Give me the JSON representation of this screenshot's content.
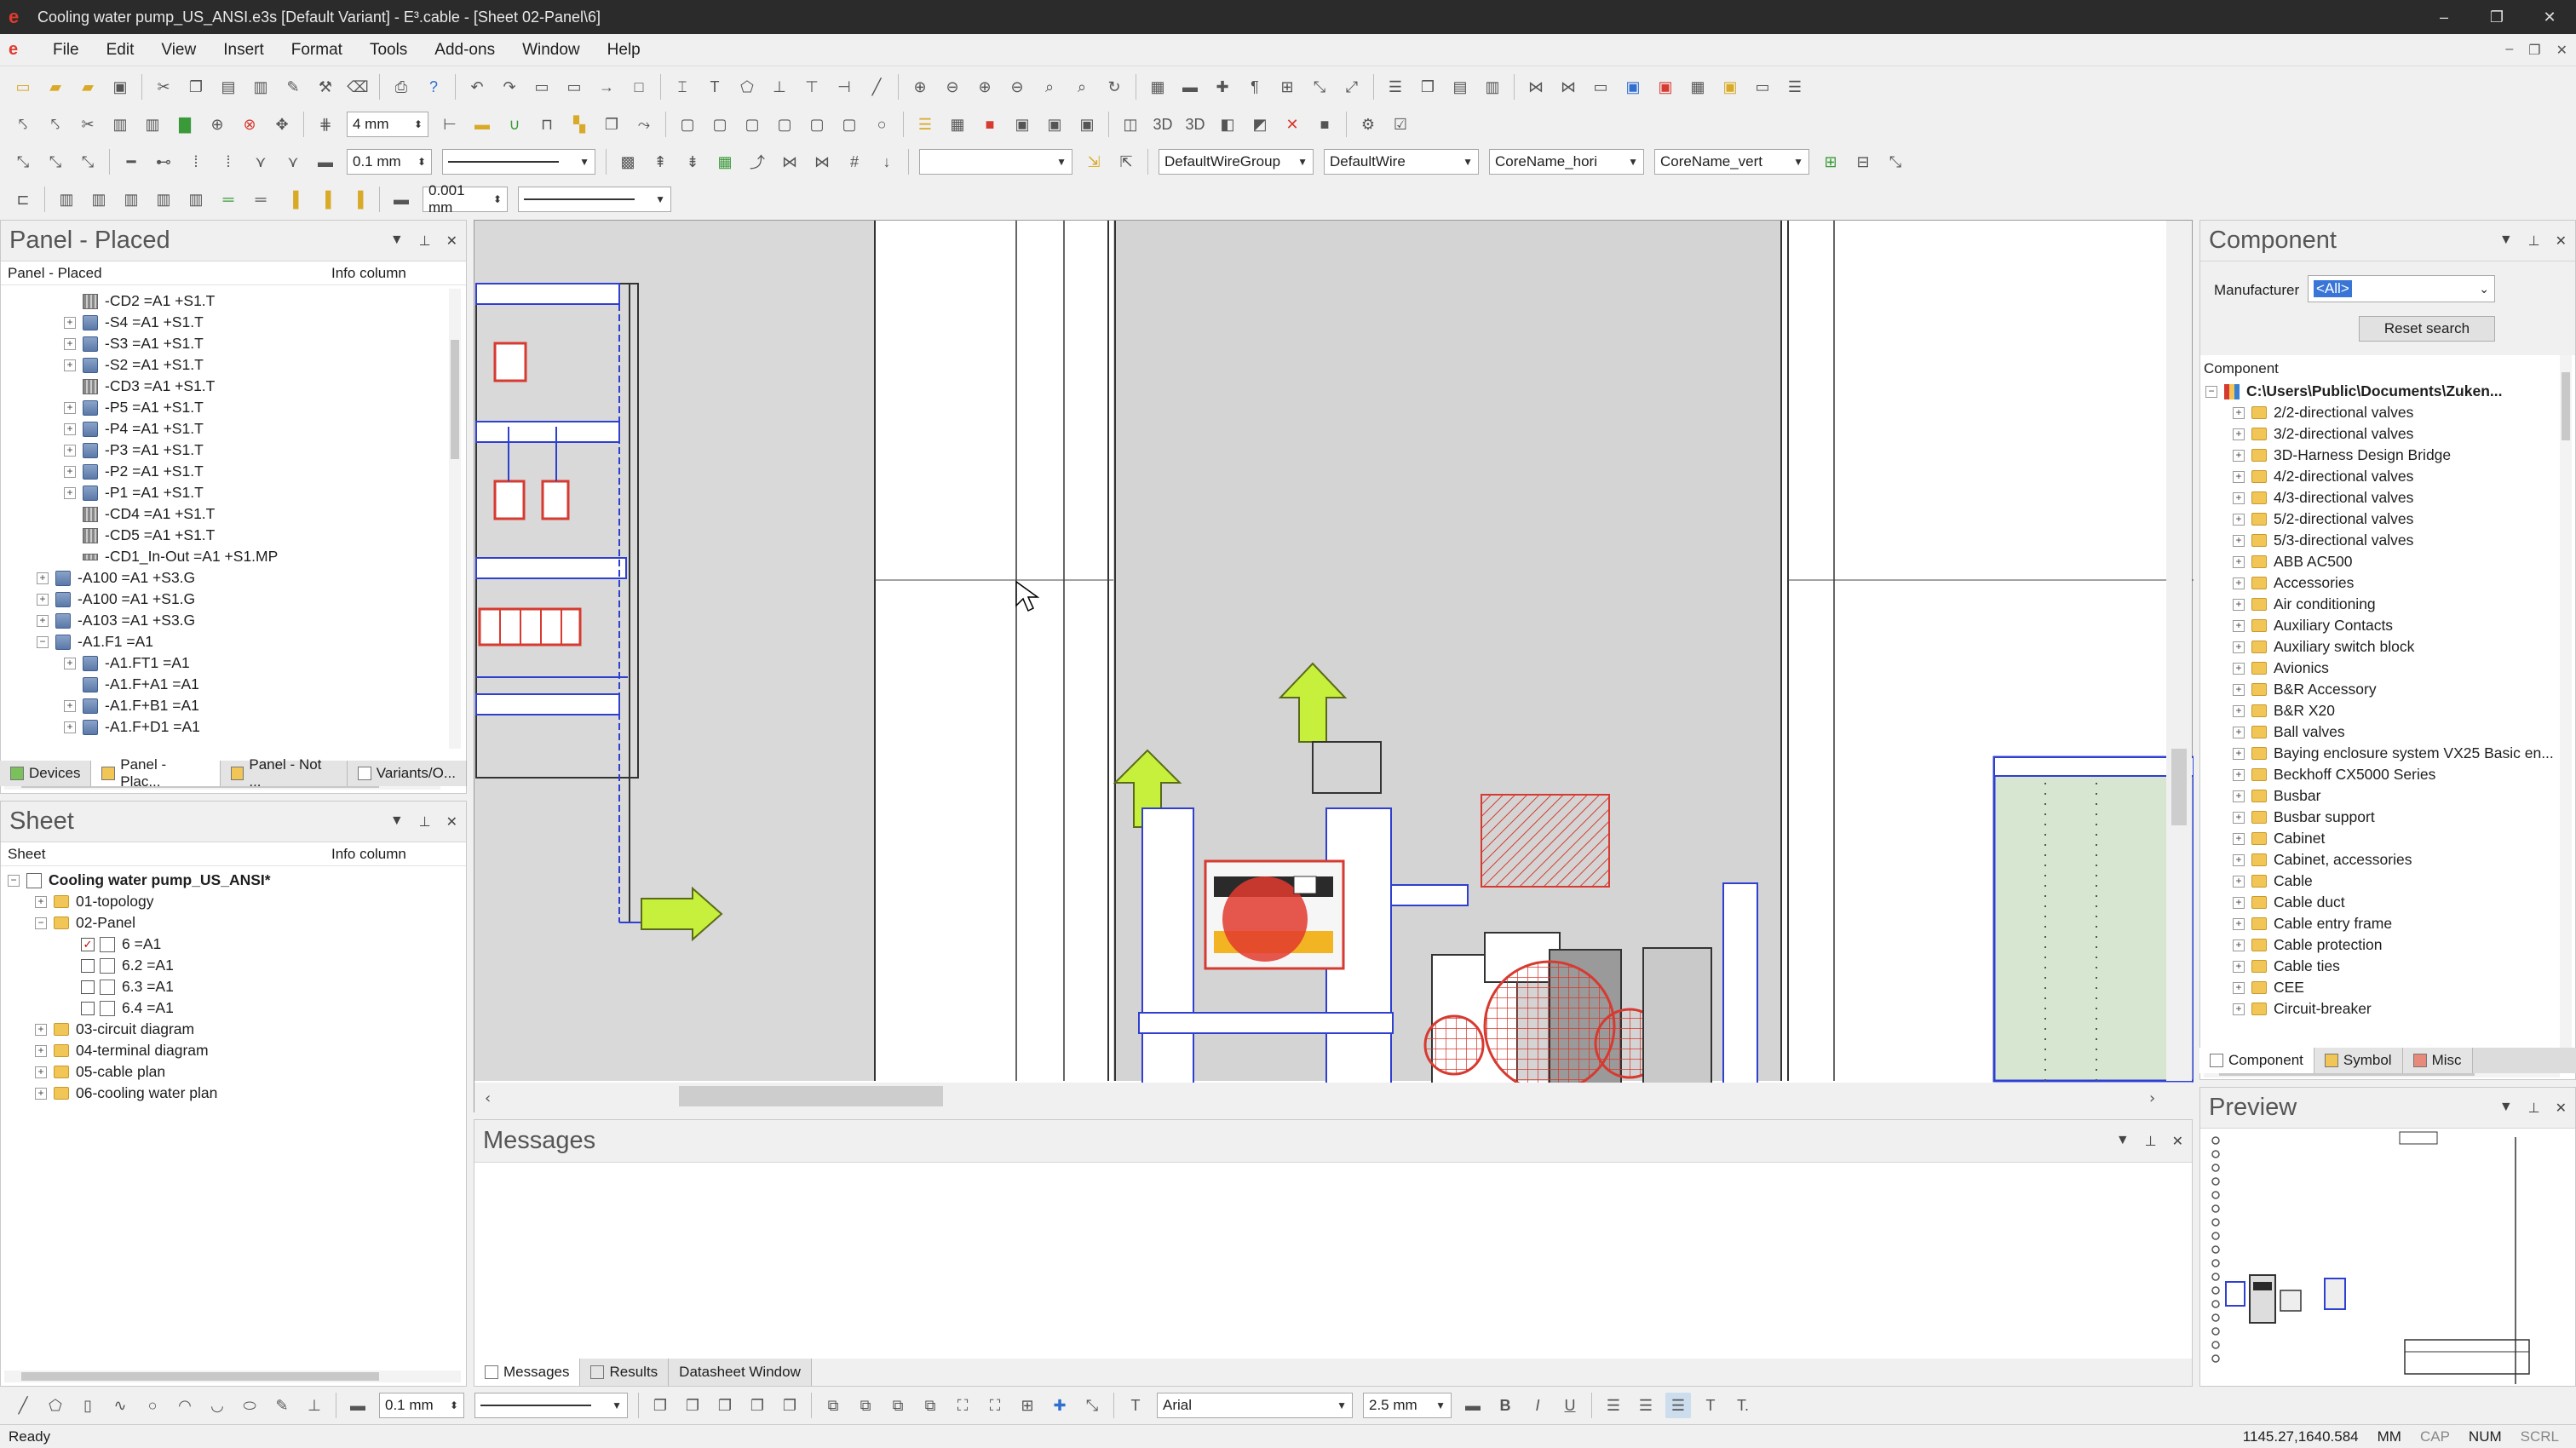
{
  "window": {
    "title": "Cooling water pump_US_ANSI.e3s [Default Variant] - E³.cable - [Sheet 02-Panel\\6]",
    "controls": [
      "–",
      "❐",
      "✕"
    ]
  },
  "menu": [
    "File",
    "Edit",
    "View",
    "Insert",
    "Format",
    "Tools",
    "Add-ons",
    "Window",
    "Help"
  ],
  "toolbar": {
    "grid_size": "4 mm",
    "line_width_1": "0.1 mm",
    "line_width_2": "0.001 mm",
    "wire_group": "DefaultWireGroup",
    "wire": "DefaultWire",
    "core_name_h": "CoreName_hori",
    "core_name_v": "CoreName_vert",
    "draw_line_width": "0.1 mm",
    "font": "Arial",
    "font_size": "2.5 mm",
    "bold": "B",
    "italic": "I",
    "underline": "U",
    "text_t1": "T",
    "text_t2": "T."
  },
  "panel_placed": {
    "title": "Panel - Placed",
    "col1": "Panel - Placed",
    "col2": "Info column",
    "items": [
      {
        "label": "-CD2 =A1 +S1.T",
        "indent": 2,
        "exp": "",
        "icon": "cable"
      },
      {
        "label": "-S4 =A1 +S1.T",
        "indent": 2,
        "exp": "+",
        "icon": "device"
      },
      {
        "label": "-S3 =A1 +S1.T",
        "indent": 2,
        "exp": "+",
        "icon": "device"
      },
      {
        "label": "-S2 =A1 +S1.T",
        "indent": 2,
        "exp": "+",
        "icon": "device"
      },
      {
        "label": "-CD3 =A1 +S1.T",
        "indent": 2,
        "exp": "",
        "icon": "cable"
      },
      {
        "label": "-P5 =A1 +S1.T",
        "indent": 2,
        "exp": "+",
        "icon": "device"
      },
      {
        "label": "-P4 =A1 +S1.T",
        "indent": 2,
        "exp": "+",
        "icon": "device"
      },
      {
        "label": "-P3 =A1 +S1.T",
        "indent": 2,
        "exp": "+",
        "icon": "device"
      },
      {
        "label": "-P2 =A1 +S1.T",
        "indent": 2,
        "exp": "+",
        "icon": "device"
      },
      {
        "label": "-P1 =A1 +S1.T",
        "indent": 2,
        "exp": "+",
        "icon": "device"
      },
      {
        "label": "-CD4 =A1 +S1.T",
        "indent": 2,
        "exp": "",
        "icon": "cable"
      },
      {
        "label": "-CD5 =A1 +S1.T",
        "indent": 2,
        "exp": "",
        "icon": "cable"
      },
      {
        "label": "-CD1_In-Out =A1 +S1.MP",
        "indent": 2,
        "exp": "",
        "icon": "small"
      },
      {
        "label": "-A100 =A1 +S3.G",
        "indent": 1,
        "exp": "+",
        "icon": "device"
      },
      {
        "label": "-A100 =A1 +S1.G",
        "indent": 1,
        "exp": "+",
        "icon": "device"
      },
      {
        "label": "-A103 =A1 +S3.G",
        "indent": 1,
        "exp": "+",
        "icon": "device"
      },
      {
        "label": "-A1.F1 =A1",
        "indent": 1,
        "exp": "−",
        "icon": "device"
      },
      {
        "label": "-A1.FT1 =A1",
        "indent": 2,
        "exp": "+",
        "icon": "device"
      },
      {
        "label": "-A1.F+A1 =A1",
        "indent": 2,
        "exp": "",
        "icon": "device"
      },
      {
        "label": "-A1.F+B1 =A1",
        "indent": 2,
        "exp": "+",
        "icon": "device"
      },
      {
        "label": "-A1.F+D1 =A1",
        "indent": 2,
        "exp": "+",
        "icon": "device"
      }
    ],
    "tabs": [
      "Devices",
      "Panel - Plac...",
      "Panel - Not ...",
      "Variants/O..."
    ]
  },
  "sheet": {
    "title": "Sheet",
    "col1": "Sheet",
    "col2": "Info column",
    "items": [
      {
        "label": "Cooling water pump_US_ANSI*",
        "indent": 0,
        "exp": "−",
        "icon": "sheet",
        "bold": true
      },
      {
        "label": "01-topology",
        "indent": 1,
        "exp": "+",
        "icon": "folder"
      },
      {
        "label": "02-Panel",
        "indent": 1,
        "exp": "−",
        "icon": "folder"
      },
      {
        "label": "6 =A1",
        "indent": 2,
        "exp": "",
        "icon": "page",
        "checked": true
      },
      {
        "label": "6.2 =A1",
        "indent": 2,
        "exp": "",
        "icon": "page"
      },
      {
        "label": "6.3 =A1",
        "indent": 2,
        "exp": "",
        "icon": "page"
      },
      {
        "label": "6.4 =A1",
        "indent": 2,
        "exp": "",
        "icon": "page"
      },
      {
        "label": "03-circuit diagram",
        "indent": 1,
        "exp": "+",
        "icon": "folder"
      },
      {
        "label": "04-terminal diagram",
        "indent": 1,
        "exp": "+",
        "icon": "folder"
      },
      {
        "label": "05-cable plan",
        "indent": 1,
        "exp": "+",
        "icon": "folder"
      },
      {
        "label": "06-cooling water plan",
        "indent": 1,
        "exp": "+",
        "icon": "folder"
      }
    ]
  },
  "messages": {
    "title": "Messages",
    "tabs": [
      "Messages",
      "Results",
      "Datasheet Window"
    ]
  },
  "component": {
    "title": "Component",
    "manufacturer_label": "Manufacturer",
    "manufacturer_value": "<All>",
    "reset_button": "Reset search",
    "tree_header": "Component",
    "root": "C:\\Users\\Public\\Documents\\Zuken...",
    "items": [
      "2/2-directional valves",
      "3/2-directional valves",
      "3D-Harness Design Bridge",
      "4/2-directional valves",
      "4/3-directional valves",
      "5/2-directional valves",
      "5/3-directional valves",
      "ABB AC500",
      "Accessories",
      "Air conditioning",
      "Auxiliary Contacts",
      "Auxiliary switch block",
      "Avionics",
      "B&R Accessory",
      "B&R X20",
      "Ball valves",
      "Baying enclosure system VX25 Basic en...",
      "Beckhoff CX5000 Series",
      "Busbar",
      "Busbar support",
      "Cabinet",
      "Cabinet, accessories",
      "Cable",
      "Cable duct",
      "Cable entry frame",
      "Cable protection",
      "Cable ties",
      "CEE",
      "Circuit-breaker"
    ],
    "tabs": [
      "Component",
      "Symbol",
      "Misc"
    ]
  },
  "preview": {
    "title": "Preview"
  },
  "status": {
    "left": "Ready",
    "coords": "1145.27,1640.584",
    "units": "MM",
    "cap": "CAP",
    "num": "NUM",
    "scrl": "SCRL"
  },
  "colors": {
    "accent_red": "#e23a2e",
    "wire_blue": "#2f3fd0",
    "arrow_green": "#c7f03c",
    "hatch_red": "#d63a30",
    "panel_bg": "#f0f0f0"
  }
}
